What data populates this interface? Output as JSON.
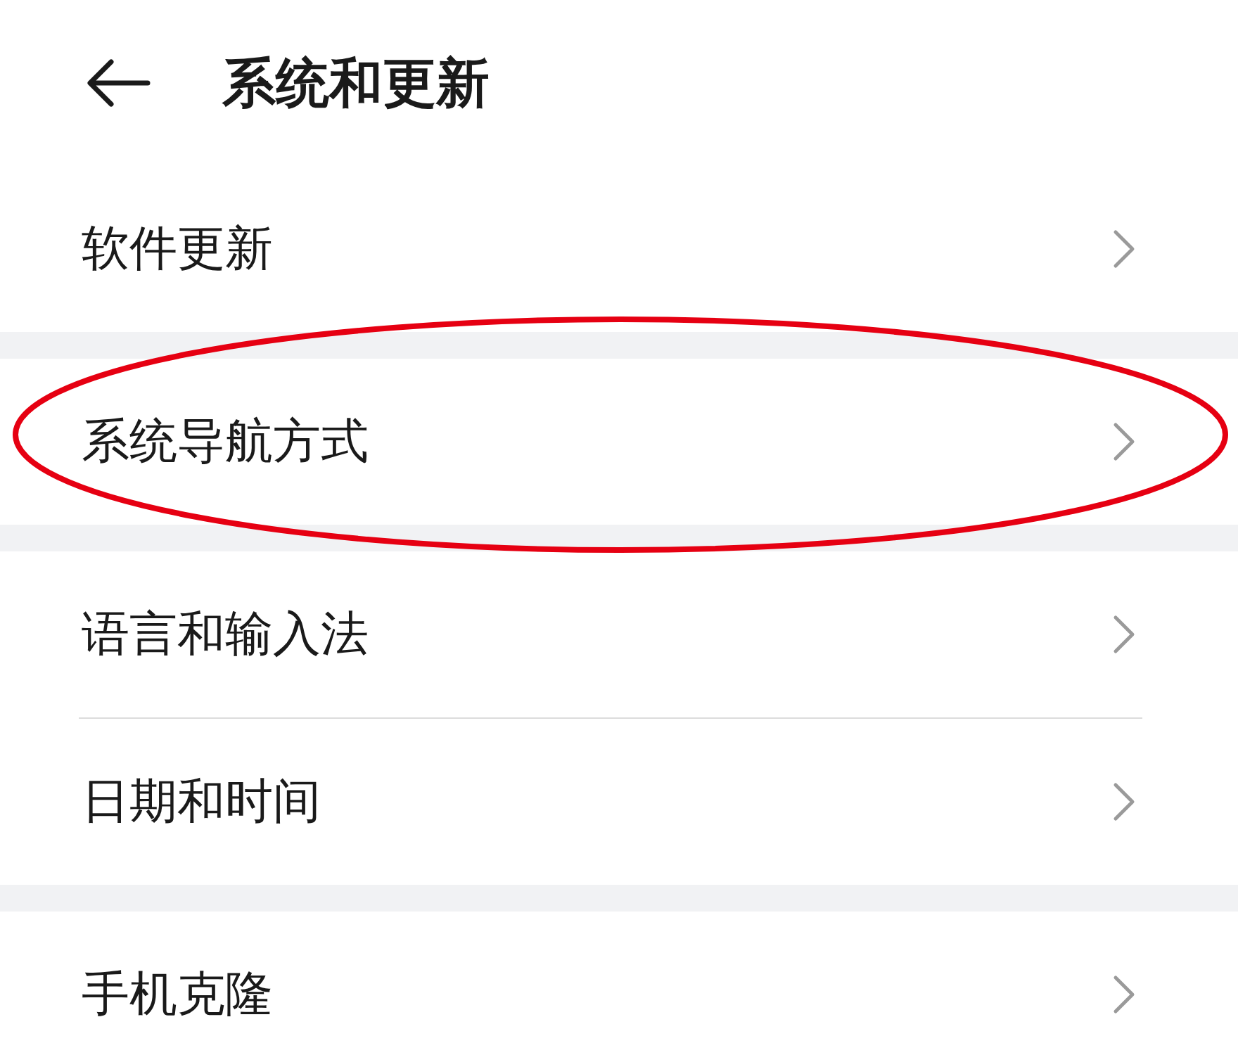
{
  "header": {
    "title": "系统和更新"
  },
  "groups": [
    {
      "items": [
        {
          "label": "软件更新",
          "circled": false
        }
      ]
    },
    {
      "items": [
        {
          "label": "系统导航方式",
          "circled": true
        }
      ]
    },
    {
      "items": [
        {
          "label": "语言和输入法",
          "circled": false
        },
        {
          "label": "日期和时间",
          "circled": false
        }
      ]
    },
    {
      "items": [
        {
          "label": "手机克隆",
          "circled": false
        }
      ]
    }
  ]
}
